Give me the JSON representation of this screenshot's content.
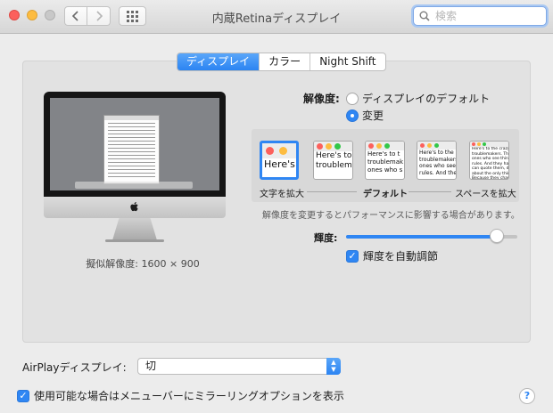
{
  "window": {
    "title": "内蔵Retinaディスプレイ"
  },
  "search": {
    "placeholder": "検索",
    "value": ""
  },
  "tabs": [
    {
      "label": "ディスプレイ",
      "active": true
    },
    {
      "label": "カラー",
      "active": false
    },
    {
      "label": "Night Shift",
      "active": false
    }
  ],
  "preview": {
    "simulated_resolution": "擬似解像度: 1600 × 900"
  },
  "resolution": {
    "label": "解像度:",
    "options": [
      {
        "label": "ディスプレイのデフォルト",
        "selected": false
      },
      {
        "label": "変更",
        "selected": true
      }
    ],
    "scale_thumbs": [
      {
        "text": "Here's",
        "selected": true
      },
      {
        "text": "Here's to\ntroublem",
        "selected": false
      },
      {
        "text": "Here's to t\ntroublemak\nones who s",
        "selected": false
      },
      {
        "text": "Here's to the\ntroublemakers\nones who see\nrules. And the",
        "selected": false
      },
      {
        "text": "Here's to the crazy one\ntroublemakers. The rou\nones who see things d\nrules. And they have\ncan quote them, disagr\nabout the only thing\nBecause they change th",
        "selected": false
      }
    ],
    "scale_labels": {
      "larger_text": "文字を拡大",
      "default": "デフォルト",
      "more_space": "スペースを拡大"
    },
    "note": "解像度を変更するとパフォーマンスに影響する場合があります。"
  },
  "brightness": {
    "label": "輝度:",
    "level": 0.88,
    "auto_label": "輝度を自動調節",
    "auto_checked": true
  },
  "airplay": {
    "label": "AirPlayディスプレイ:",
    "selected": "切"
  },
  "mirror_option": {
    "label": "使用可能な場合はメニューバーにミラーリングオプションを表示",
    "checked": true
  },
  "help_label": "?",
  "colors": {
    "accent": "#2f86f3",
    "close": "#fc605c",
    "minimize": "#fdbc40",
    "zoom_inactive": "#c8c8c8"
  }
}
